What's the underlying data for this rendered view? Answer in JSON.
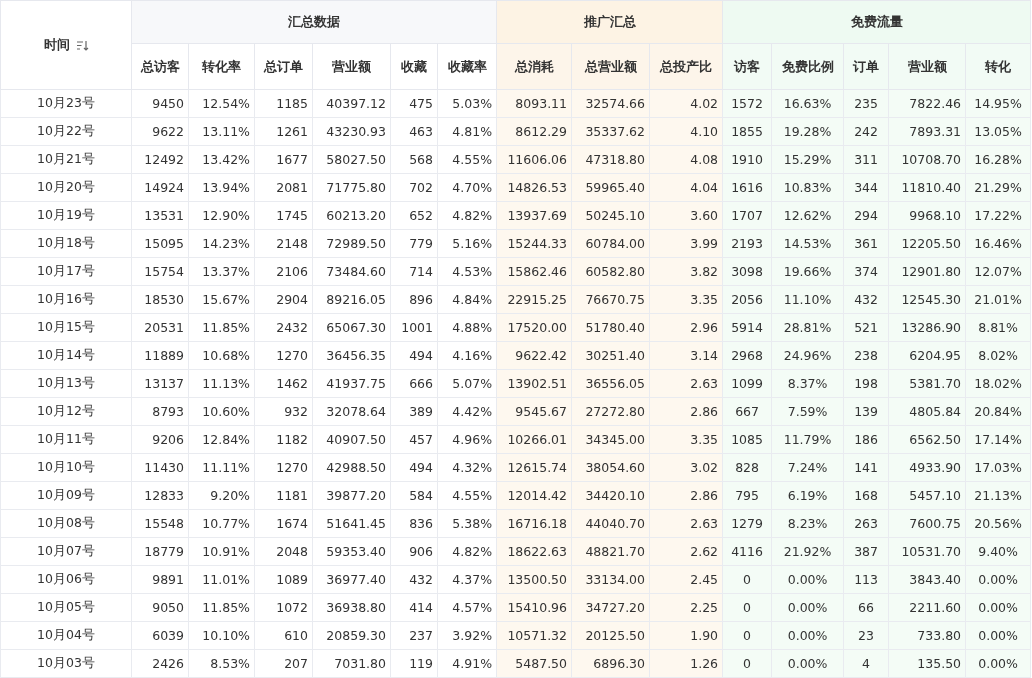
{
  "time_header": "时间",
  "groups": [
    {
      "title": "汇总数据",
      "kind": "summary",
      "columns": [
        "总访客",
        "转化率",
        "总订单",
        "营业额",
        "收藏",
        "收藏率"
      ]
    },
    {
      "title": "推广汇总",
      "kind": "promo",
      "columns": [
        "总消耗",
        "总营业额",
        "总投产比"
      ]
    },
    {
      "title": "免费流量",
      "kind": "free",
      "columns": [
        "访客",
        "免费比例",
        "订单",
        "营业额",
        "转化"
      ]
    }
  ],
  "rows": [
    {
      "time": "10月23号",
      "cells": [
        "9450",
        "12.54%",
        "1185",
        "40397.12",
        "475",
        "5.03%",
        "8093.11",
        "32574.66",
        "4.02",
        "1572",
        "16.63%",
        "235",
        "7822.46",
        "14.95%"
      ]
    },
    {
      "time": "10月22号",
      "cells": [
        "9622",
        "13.11%",
        "1261",
        "43230.93",
        "463",
        "4.81%",
        "8612.29",
        "35337.62",
        "4.10",
        "1855",
        "19.28%",
        "242",
        "7893.31",
        "13.05%"
      ]
    },
    {
      "time": "10月21号",
      "cells": [
        "12492",
        "13.42%",
        "1677",
        "58027.50",
        "568",
        "4.55%",
        "11606.06",
        "47318.80",
        "4.08",
        "1910",
        "15.29%",
        "311",
        "10708.70",
        "16.28%"
      ]
    },
    {
      "time": "10月20号",
      "cells": [
        "14924",
        "13.94%",
        "2081",
        "71775.80",
        "702",
        "4.70%",
        "14826.53",
        "59965.40",
        "4.04",
        "1616",
        "10.83%",
        "344",
        "11810.40",
        "21.29%"
      ]
    },
    {
      "time": "10月19号",
      "cells": [
        "13531",
        "12.90%",
        "1745",
        "60213.20",
        "652",
        "4.82%",
        "13937.69",
        "50245.10",
        "3.60",
        "1707",
        "12.62%",
        "294",
        "9968.10",
        "17.22%"
      ]
    },
    {
      "time": "10月18号",
      "cells": [
        "15095",
        "14.23%",
        "2148",
        "72989.50",
        "779",
        "5.16%",
        "15244.33",
        "60784.00",
        "3.99",
        "2193",
        "14.53%",
        "361",
        "12205.50",
        "16.46%"
      ]
    },
    {
      "time": "10月17号",
      "cells": [
        "15754",
        "13.37%",
        "2106",
        "73484.60",
        "714",
        "4.53%",
        "15862.46",
        "60582.80",
        "3.82",
        "3098",
        "19.66%",
        "374",
        "12901.80",
        "12.07%"
      ]
    },
    {
      "time": "10月16号",
      "cells": [
        "18530",
        "15.67%",
        "2904",
        "89216.05",
        "896",
        "4.84%",
        "22915.25",
        "76670.75",
        "3.35",
        "2056",
        "11.10%",
        "432",
        "12545.30",
        "21.01%"
      ]
    },
    {
      "time": "10月15号",
      "cells": [
        "20531",
        "11.85%",
        "2432",
        "65067.30",
        "1001",
        "4.88%",
        "17520.00",
        "51780.40",
        "2.96",
        "5914",
        "28.81%",
        "521",
        "13286.90",
        "8.81%"
      ]
    },
    {
      "time": "10月14号",
      "cells": [
        "11889",
        "10.68%",
        "1270",
        "36456.35",
        "494",
        "4.16%",
        "9622.42",
        "30251.40",
        "3.14",
        "2968",
        "24.96%",
        "238",
        "6204.95",
        "8.02%"
      ]
    },
    {
      "time": "10月13号",
      "cells": [
        "13137",
        "11.13%",
        "1462",
        "41937.75",
        "666",
        "5.07%",
        "13902.51",
        "36556.05",
        "2.63",
        "1099",
        "8.37%",
        "198",
        "5381.70",
        "18.02%"
      ]
    },
    {
      "time": "10月12号",
      "cells": [
        "8793",
        "10.60%",
        "932",
        "32078.64",
        "389",
        "4.42%",
        "9545.67",
        "27272.80",
        "2.86",
        "667",
        "7.59%",
        "139",
        "4805.84",
        "20.84%"
      ]
    },
    {
      "time": "10月11号",
      "cells": [
        "9206",
        "12.84%",
        "1182",
        "40907.50",
        "457",
        "4.96%",
        "10266.01",
        "34345.00",
        "3.35",
        "1085",
        "11.79%",
        "186",
        "6562.50",
        "17.14%"
      ]
    },
    {
      "time": "10月10号",
      "cells": [
        "11430",
        "11.11%",
        "1270",
        "42988.50",
        "494",
        "4.32%",
        "12615.74",
        "38054.60",
        "3.02",
        "828",
        "7.24%",
        "141",
        "4933.90",
        "17.03%"
      ]
    },
    {
      "time": "10月09号",
      "cells": [
        "12833",
        "9.20%",
        "1181",
        "39877.20",
        "584",
        "4.55%",
        "12014.42",
        "34420.10",
        "2.86",
        "795",
        "6.19%",
        "168",
        "5457.10",
        "21.13%"
      ]
    },
    {
      "time": "10月08号",
      "cells": [
        "15548",
        "10.77%",
        "1674",
        "51641.45",
        "836",
        "5.38%",
        "16716.18",
        "44040.70",
        "2.63",
        "1279",
        "8.23%",
        "263",
        "7600.75",
        "20.56%"
      ]
    },
    {
      "time": "10月07号",
      "cells": [
        "18779",
        "10.91%",
        "2048",
        "59353.40",
        "906",
        "4.82%",
        "18622.63",
        "48821.70",
        "2.62",
        "4116",
        "21.92%",
        "387",
        "10531.70",
        "9.40%"
      ]
    },
    {
      "time": "10月06号",
      "cells": [
        "9891",
        "11.01%",
        "1089",
        "36977.40",
        "432",
        "4.37%",
        "13500.50",
        "33134.00",
        "2.45",
        "0",
        "0.00%",
        "113",
        "3843.40",
        "0.00%"
      ]
    },
    {
      "time": "10月05号",
      "cells": [
        "9050",
        "11.85%",
        "1072",
        "36938.80",
        "414",
        "4.57%",
        "15410.96",
        "34727.20",
        "2.25",
        "0",
        "0.00%",
        "66",
        "2211.60",
        "0.00%"
      ]
    },
    {
      "time": "10月04号",
      "cells": [
        "6039",
        "10.10%",
        "610",
        "20859.30",
        "237",
        "3.92%",
        "10571.32",
        "20125.50",
        "1.90",
        "0",
        "0.00%",
        "23",
        "733.80",
        "0.00%"
      ]
    },
    {
      "time": "10月03号",
      "cells": [
        "2426",
        "8.53%",
        "207",
        "7031.80",
        "119",
        "4.91%",
        "5487.50",
        "6896.30",
        "1.26",
        "0",
        "0.00%",
        "4",
        "135.50",
        "0.00%"
      ]
    }
  ]
}
